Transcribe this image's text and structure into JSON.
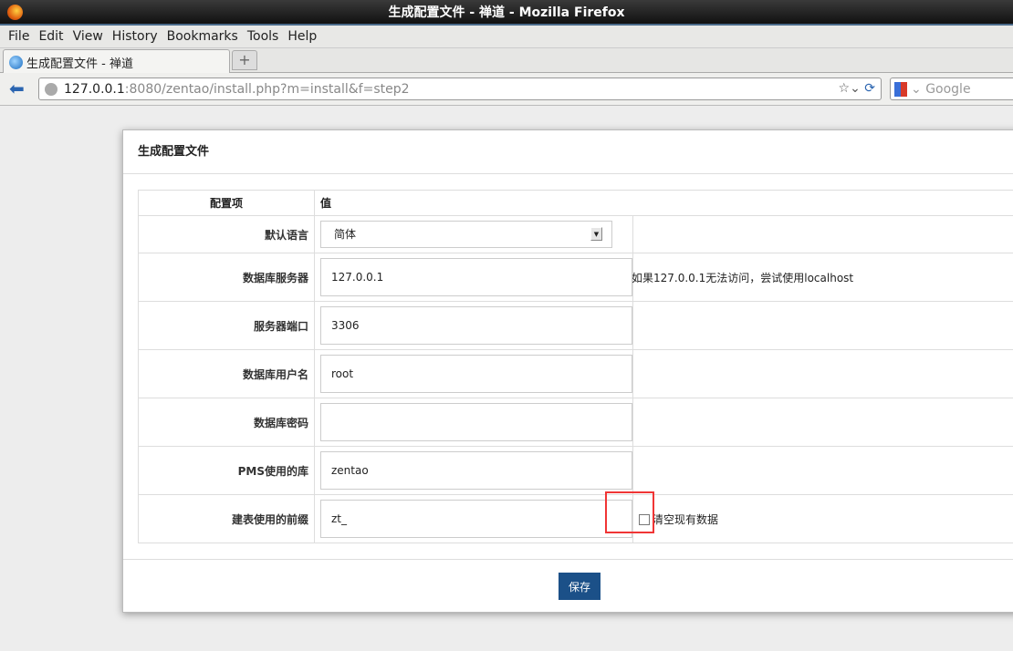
{
  "window": {
    "title": "生成配置文件 - 禅道 - Mozilla Firefox"
  },
  "menu": [
    "File",
    "Edit",
    "View",
    "History",
    "Bookmarks",
    "Tools",
    "Help"
  ],
  "tab": {
    "label": "生成配置文件 - 禅道",
    "new_tab": "+"
  },
  "nav": {
    "url_host": "127.0.0.1",
    "url_rest": ":8080/zentao/install.php?m=install&f=step2",
    "search_placeholder": "Google"
  },
  "page": {
    "title": "生成配置文件",
    "col_item": "配置项",
    "col_value": "值",
    "language": {
      "label": "默认语言",
      "value": "简体"
    },
    "db_host": {
      "label": "数据库服务器",
      "value": "127.0.0.1",
      "hint": "如果127.0.0.1无法访问，尝试使用localhost"
    },
    "db_port": {
      "label": "服务器端口",
      "value": "3306"
    },
    "db_user": {
      "label": "数据库用户名",
      "value": "root"
    },
    "db_password": {
      "label": "数据库密码",
      "value": ""
    },
    "db_name": {
      "label": "PMS使用的库",
      "value": "zentao"
    },
    "db_prefix": {
      "label": "建表使用的前缀",
      "value": "zt_",
      "clear_label": "清空现有数据"
    },
    "save": "保存"
  },
  "colors": {
    "save_button": "#1b5088",
    "highlight": "#f03535"
  }
}
